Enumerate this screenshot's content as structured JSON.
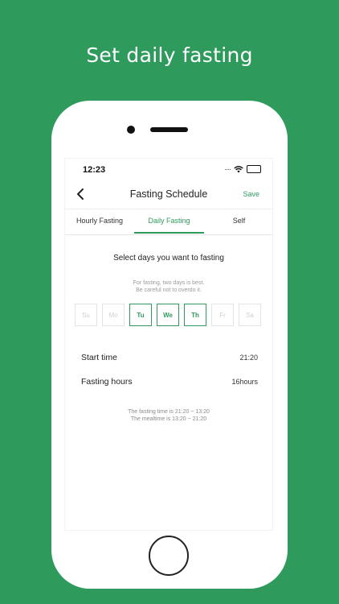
{
  "headline": "Set daily fasting",
  "status_bar": {
    "time": "12:23",
    "signal_dots": "····"
  },
  "nav": {
    "title": "Fasting Schedule",
    "save_label": "Save"
  },
  "tabs": [
    {
      "label": "Hourly Fasting",
      "active": false
    },
    {
      "label": "Daily Fasting",
      "active": true
    },
    {
      "label": "Self",
      "active": false
    }
  ],
  "prompt": "Select days you want to fasting",
  "hint": {
    "line1": "For fasting, two days is best.",
    "line2": "Be careful not to overdo it."
  },
  "days": [
    {
      "label": "Su",
      "selected": false
    },
    {
      "label": "Mo",
      "selected": false
    },
    {
      "label": "Tu",
      "selected": true
    },
    {
      "label": "We",
      "selected": true
    },
    {
      "label": "Th",
      "selected": true
    },
    {
      "label": "Fr",
      "selected": false
    },
    {
      "label": "Sa",
      "selected": false
    }
  ],
  "start_time": {
    "label": "Start time",
    "value": "21:20"
  },
  "fasting_hours": {
    "label": "Fasting hours",
    "value": "16hours"
  },
  "note": {
    "line1": "The fasting time is 21:20 ~ 13:20",
    "line2": "The mealtime is 13:20 ~ 21:20"
  },
  "colors": {
    "accent": "#2e9a5c",
    "background": "#2e9a5c"
  },
  "icons": {
    "back": "chevron-left-icon",
    "wifi": "wifi-icon",
    "battery": "battery-icon"
  }
}
